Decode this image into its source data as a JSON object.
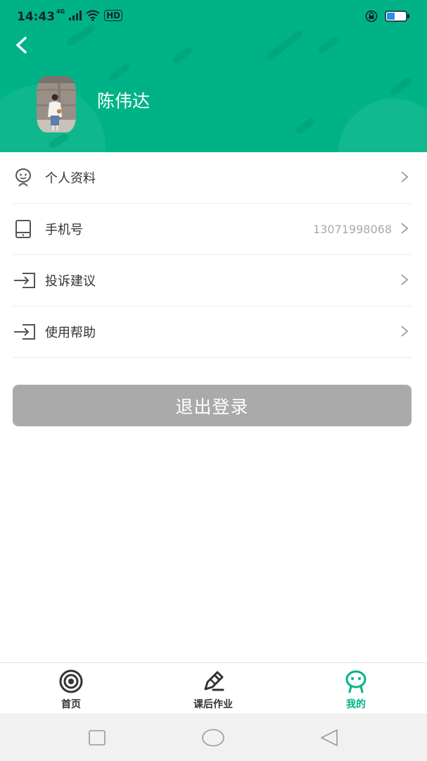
{
  "status_bar": {
    "time": "14:43",
    "network": "4G",
    "hd": "HD"
  },
  "header": {
    "user_name": "陈伟达"
  },
  "menu": [
    {
      "label": "个人资料",
      "value": "",
      "icon": "face-icon"
    },
    {
      "label": "手机号",
      "value": "13071998068",
      "icon": "tablet-icon"
    },
    {
      "label": "投诉建议",
      "value": "",
      "icon": "login-arrow-icon"
    },
    {
      "label": "使用帮助",
      "value": "",
      "icon": "login-arrow-icon"
    }
  ],
  "logout_label": "退出登录",
  "tabs": [
    {
      "label": "首页",
      "icon": "target-icon",
      "active": false
    },
    {
      "label": "课后作业",
      "icon": "pencil-icon",
      "active": false
    },
    {
      "label": "我的",
      "icon": "robot-face-icon",
      "active": true
    }
  ],
  "colors": {
    "primary": "#00b386",
    "logout_bg": "#aaaaaa",
    "text": "#333333",
    "muted": "#aaaaaa"
  }
}
